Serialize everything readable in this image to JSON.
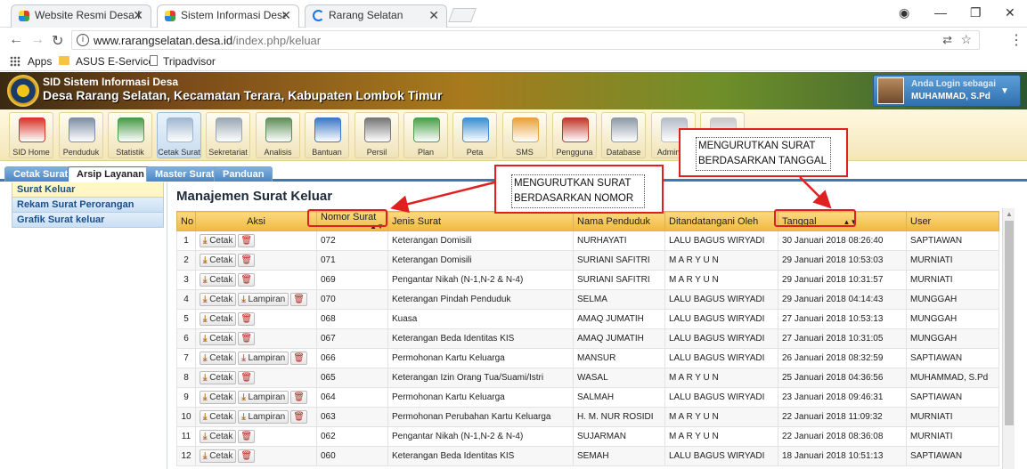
{
  "browser": {
    "tabs": [
      {
        "title": "Website Resmi Desa Rara",
        "active": false
      },
      {
        "title": "Sistem Informasi Desa D",
        "active": true
      },
      {
        "title": "Rarang Selatan",
        "active": false
      }
    ],
    "url_host": "www.rarangselatan.desa.id",
    "url_path": "/index.php/keluar",
    "bookmarks": [
      "Apps",
      "ASUS E-Service",
      "Tripadvisor"
    ]
  },
  "site": {
    "line1": "SID Sistem Informasi Desa",
    "line2": "Desa Rarang Selatan, Kecamatan Terara, Kabupaten Lombok Timur",
    "login_label": "Anda Login sebagai",
    "login_name": "MUHAMMAD, S.Pd"
  },
  "toolbar": [
    {
      "label": "SID Home",
      "icon": "home-icon",
      "color": "#d8362b"
    },
    {
      "label": "Penduduk",
      "icon": "people-icon",
      "color": "#7d8fa6"
    },
    {
      "label": "Statistik",
      "icon": "chart-icon",
      "color": "#4a9a48"
    },
    {
      "label": "Cetak Surat",
      "icon": "document-icon",
      "color": "#9fb7cf"
    },
    {
      "label": "Sekretariat",
      "icon": "folder-icon",
      "color": "#9aa7b4"
    },
    {
      "label": "Analisis",
      "icon": "analysis-icon",
      "color": "#5f8f59"
    },
    {
      "label": "Bantuan",
      "icon": "book-icon",
      "color": "#3d78c7"
    },
    {
      "label": "Persil",
      "icon": "map-icon",
      "color": "#777777"
    },
    {
      "label": "Plan",
      "icon": "globe-plan-icon",
      "color": "#4aa04a"
    },
    {
      "label": "Peta",
      "icon": "globe-icon",
      "color": "#3b8fd1"
    },
    {
      "label": "SMS",
      "icon": "sms-icon",
      "color": "#e9a23b"
    },
    {
      "label": "Pengguna",
      "icon": "users-icon",
      "color": "#c0392b"
    },
    {
      "label": "Database",
      "icon": "database-icon",
      "color": "#8e9aa6"
    },
    {
      "label": "Admin W",
      "icon": "admin-icon",
      "color": "#b3bcc7"
    },
    {
      "label": "",
      "icon": "mail-icon",
      "color": "#c9c9c9"
    }
  ],
  "tabs": [
    "Cetak Surat",
    "Arsip Layanan",
    "Master Surat",
    "Panduan"
  ],
  "sidebar": [
    "Surat Keluar",
    "Rekam Surat Perorangan",
    "Grafik Surat keluar"
  ],
  "page_title": "Manajemen Surat Keluar",
  "table": {
    "headers": [
      "No",
      "Aksi",
      "Nomor Surat",
      "Jenis Surat",
      "Nama Penduduk",
      "Ditandatangani Oleh",
      "Tanggal",
      "User"
    ],
    "labels": {
      "cetak": "Cetak",
      "lampiran": "Lampiran"
    },
    "rows": [
      {
        "no": "1",
        "lampiran": false,
        "nomor": "072",
        "jenis": "Keterangan Domisili",
        "nama": "NURHAYATI",
        "ttd": "LALU BAGUS WIRYADI",
        "tanggal": "30 Januari 2018 08:26:40",
        "user": "SAPTIAWAN"
      },
      {
        "no": "2",
        "lampiran": false,
        "nomor": "071",
        "jenis": "Keterangan Domisili",
        "nama": "SURIANI SAFITRI",
        "ttd": "M A R Y U N",
        "tanggal": "29 Januari 2018 10:53:03",
        "user": "MURNIATI"
      },
      {
        "no": "3",
        "lampiran": false,
        "nomor": "069",
        "jenis": "Pengantar Nikah (N-1,N-2 & N-4)",
        "nama": "SURIANI SAFITRI",
        "ttd": "M A R Y U N",
        "tanggal": "29 Januari 2018 10:31:57",
        "user": "MURNIATI"
      },
      {
        "no": "4",
        "lampiran": true,
        "nomor": "070",
        "jenis": "Keterangan Pindah Penduduk",
        "nama": "SELMA",
        "ttd": "LALU BAGUS WIRYADI",
        "tanggal": "29 Januari 2018 04:14:43",
        "user": "MUNGGAH"
      },
      {
        "no": "5",
        "lampiran": false,
        "nomor": "068",
        "jenis": "Kuasa",
        "nama": "AMAQ JUMATIH",
        "ttd": "LALU BAGUS WIRYADI",
        "tanggal": "27 Januari 2018 10:53:13",
        "user": "MUNGGAH"
      },
      {
        "no": "6",
        "lampiran": false,
        "nomor": "067",
        "jenis": "Keterangan Beda Identitas KIS",
        "nama": "AMAQ JUMATIH",
        "ttd": "LALU BAGUS WIRYADI",
        "tanggal": "27 Januari 2018 10:31:05",
        "user": "MUNGGAH"
      },
      {
        "no": "7",
        "lampiran": true,
        "nomor": "066",
        "jenis": "Permohonan Kartu Keluarga",
        "nama": "MANSUR",
        "ttd": "LALU BAGUS WIRYADI",
        "tanggal": "26 Januari 2018 08:32:59",
        "user": "SAPTIAWAN"
      },
      {
        "no": "8",
        "lampiran": false,
        "nomor": "065",
        "jenis": "Keterangan Izin Orang Tua/Suami/Istri",
        "nama": "WASAL",
        "ttd": "M A R Y U N",
        "tanggal": "25 Januari 2018 04:36:56",
        "user": "MUHAMMAD, S.Pd"
      },
      {
        "no": "9",
        "lampiran": true,
        "nomor": "064",
        "jenis": "Permohonan Kartu Keluarga",
        "nama": "SALMAH",
        "ttd": "LALU BAGUS WIRYADI",
        "tanggal": "23 Januari 2018 09:46:31",
        "user": "SAPTIAWAN"
      },
      {
        "no": "10",
        "lampiran": true,
        "nomor": "063",
        "jenis": "Permohonan Perubahan Kartu Keluarga",
        "nama": "H. M. NUR ROSIDI",
        "ttd": "M A R Y U N",
        "tanggal": "22 Januari 2018 11:09:32",
        "user": "MURNIATI"
      },
      {
        "no": "11",
        "lampiran": false,
        "nomor": "062",
        "jenis": "Pengantar Nikah (N-1,N-2 & N-4)",
        "nama": "SUJARMAN",
        "ttd": "M A R Y U N",
        "tanggal": "22 Januari 2018 08:36:08",
        "user": "MURNIATI"
      },
      {
        "no": "12",
        "lampiran": false,
        "nomor": "060",
        "jenis": "Keterangan Beda Identitas KIS",
        "nama": "SEMAH",
        "ttd": "LALU BAGUS WIRYADI",
        "tanggal": "18 Januari 2018 10:51:13",
        "user": "SAPTIAWAN"
      }
    ]
  },
  "annotations": {
    "nomor": "MENGURUTKAN SURAT BERDASARKAN NOMOR",
    "tanggal": "MENGURUTKAN SURAT BERDASARKAN TANGGAL"
  }
}
